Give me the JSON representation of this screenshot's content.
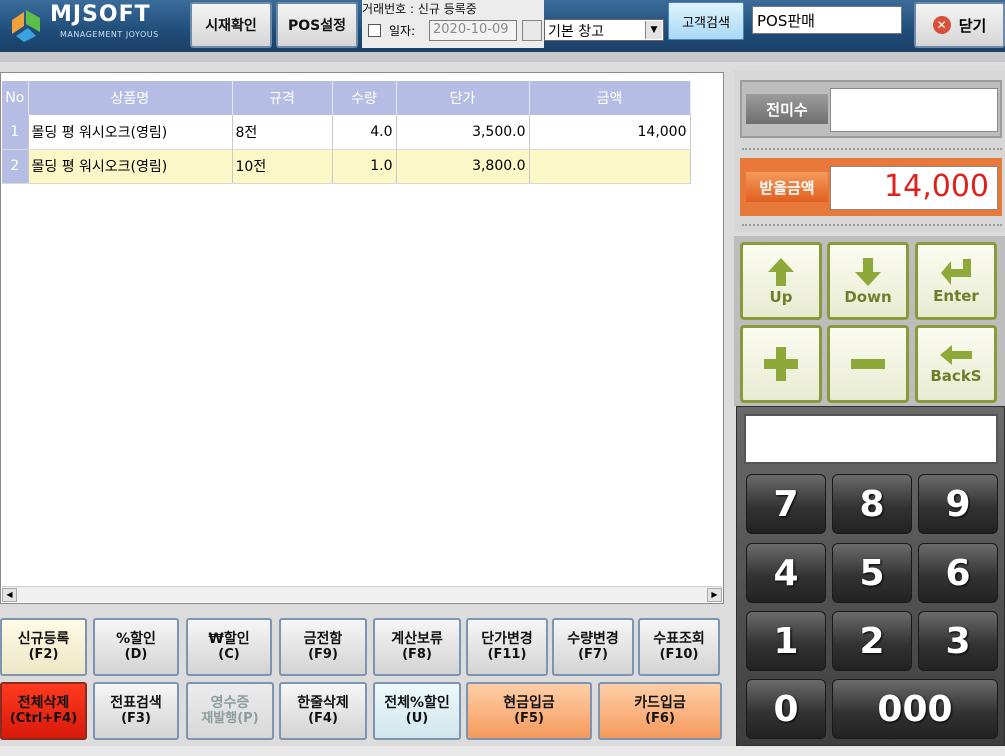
{
  "brand": {
    "name": "MJSOFT",
    "tagline": "MANAGEMENT JOYOUS"
  },
  "toolbar": {
    "price_check": "시재확인",
    "pos_settings": "POS설정",
    "deal_no_label": "거래번호 : 신규 등록중",
    "date_label": "일자:",
    "date_value": "2020-10-09",
    "warehouse": "기본 창고",
    "customer_search": "고객검색",
    "pos_mode": "POS판매",
    "close": "닫기"
  },
  "grid": {
    "columns": [
      "No",
      "상품명",
      "규격",
      "수량",
      "단가",
      "금액"
    ],
    "rows": [
      {
        "no": "1",
        "name": "몰딩 평 워시오크(영림)",
        "spec": "8전",
        "qty": "4.0",
        "price": "3,500.0",
        "amount": "14,000"
      },
      {
        "no": "2",
        "name": "몰딩 평 워시오크(영림)",
        "spec": "10전",
        "qty": "1.0",
        "price": "3,800.0",
        "amount": ""
      }
    ]
  },
  "buttons": {
    "new": {
      "label": "신규등록",
      "key": "(F2)"
    },
    "pct_discount": {
      "label": "%할인",
      "key": "(D)"
    },
    "won_discount": {
      "label": "₩할인",
      "key": "(C)"
    },
    "cash_drawer": {
      "label": "금전함",
      "key": "(F9)"
    },
    "hold": {
      "label": "계산보류",
      "key": "(F8)"
    },
    "price_change": {
      "label": "단가변경",
      "key": "(F11)"
    },
    "qty_change": {
      "label": "수량변경",
      "key": "(F7)"
    },
    "check_lookup": {
      "label": "수표조회",
      "key": "(F10)"
    },
    "delete_all": {
      "label": "전체삭제",
      "key": "(Ctrl+F4)"
    },
    "slip_search": {
      "label": "전표검색",
      "key": "(F3)"
    },
    "receipt": {
      "label": "영수증",
      "key": "재발행(P)"
    },
    "delete_one": {
      "label": "한줄삭제",
      "key": "(F4)"
    },
    "all_pct_discount": {
      "label": "전체%할인",
      "key": "(U)"
    },
    "cash_in": {
      "label": "현금입금",
      "key": "(F5)"
    },
    "card_in": {
      "label": "카드입금",
      "key": "(F6)"
    }
  },
  "summary": {
    "prev_label": "전미수",
    "prev_value": "",
    "receive_label": "받을금액",
    "receive_value": "14,000"
  },
  "nav": {
    "up": "Up",
    "down": "Down",
    "enter": "Enter",
    "backspace": "BackS"
  },
  "keypad": {
    "keys": [
      "7",
      "8",
      "9",
      "4",
      "5",
      "6",
      "1",
      "2",
      "3",
      "0",
      "000"
    ]
  },
  "colors": {
    "header_blue": "#b5bde4",
    "selected_row": "#fbf7c7",
    "receive_red": "#e0201a",
    "nav_green": "#8a9a3a"
  }
}
